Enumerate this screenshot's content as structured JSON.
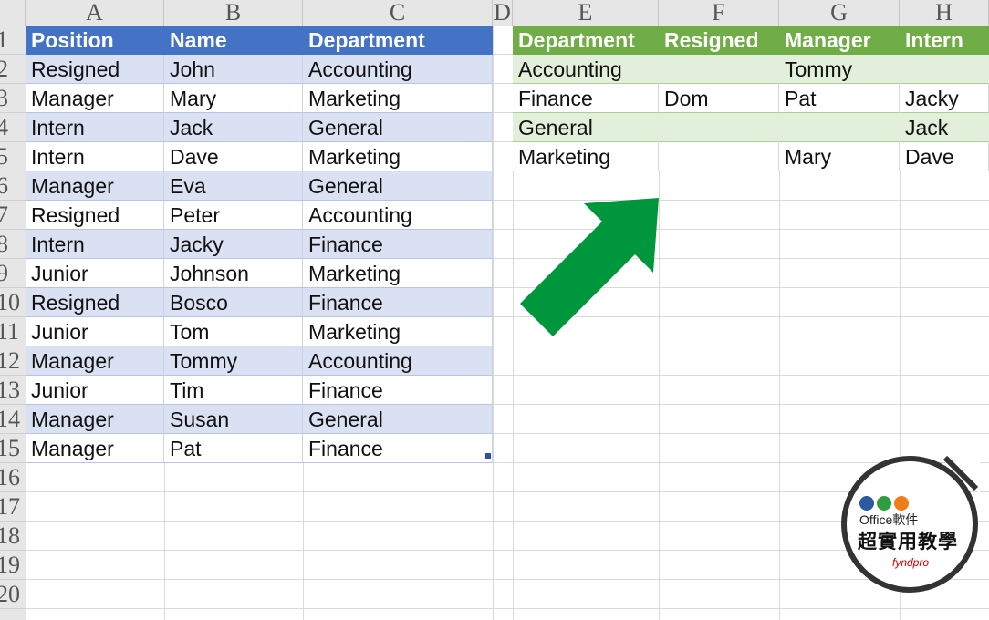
{
  "columns": [
    "A",
    "B",
    "C",
    "D",
    "E",
    "F",
    "G",
    "H"
  ],
  "rows": [
    "1",
    "2",
    "3",
    "4",
    "5",
    "6",
    "7",
    "8",
    "9",
    "10",
    "11",
    "12",
    "13",
    "14",
    "15",
    "16",
    "17",
    "18",
    "19",
    "20"
  ],
  "left_table": {
    "headers": [
      "Position",
      "Name",
      "Department"
    ],
    "rows": [
      [
        "Resigned",
        "John",
        "Accounting"
      ],
      [
        "Manager",
        "Mary",
        "Marketing"
      ],
      [
        "Intern",
        "Jack",
        "General"
      ],
      [
        "Intern",
        "Dave",
        "Marketing"
      ],
      [
        "Manager",
        "Eva",
        "General"
      ],
      [
        "Resigned",
        "Peter",
        "Accounting"
      ],
      [
        "Intern",
        "Jacky",
        "Finance"
      ],
      [
        "Junior",
        "Johnson",
        "Marketing"
      ],
      [
        "Resigned",
        "Bosco",
        "Finance"
      ],
      [
        "Junior",
        "Tom",
        "Marketing"
      ],
      [
        "Manager",
        "Tommy",
        "Accounting"
      ],
      [
        "Junior",
        "Tim",
        "Finance"
      ],
      [
        "Manager",
        "Susan",
        "General"
      ],
      [
        "Manager",
        "Pat",
        "Finance"
      ]
    ]
  },
  "right_table": {
    "headers": [
      "Department",
      "Resigned",
      "Manager",
      "Intern"
    ],
    "rows": [
      [
        "Accounting",
        "",
        "Tommy",
        ""
      ],
      [
        "Finance",
        "Dom",
        "Pat",
        "Jacky"
      ],
      [
        "General",
        "",
        "",
        "Jack"
      ],
      [
        "Marketing",
        "",
        "Mary",
        "Dave"
      ]
    ]
  },
  "colors": {
    "left_header": "#4472c4",
    "left_band": "#d9e1f2",
    "right_header": "#70ad47",
    "right_band": "#e2efda",
    "arrow": "#00963c"
  },
  "badge": {
    "line1": "Office軟件",
    "line2": "超實用教學",
    "logo_text": "fyndpro",
    "dot_colors": [
      "#2c5aa0",
      "#2e9e3e",
      "#f07d1a"
    ]
  }
}
